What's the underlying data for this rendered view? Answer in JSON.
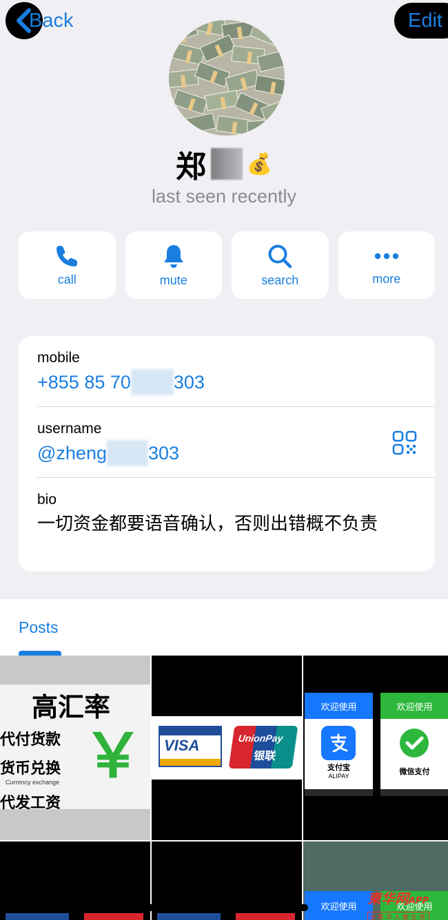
{
  "nav": {
    "back_label": "Back",
    "edit_label": "Edit"
  },
  "profile": {
    "name_visible": "郑",
    "name_emoji": "💰",
    "status": "last seen recently",
    "avatar_icon": "money-stacks-avatar"
  },
  "actions": [
    {
      "label": "call",
      "icon": "phone-icon"
    },
    {
      "label": "mute",
      "icon": "bell-icon"
    },
    {
      "label": "search",
      "icon": "search-icon"
    },
    {
      "label": "more",
      "icon": "ellipsis-icon"
    }
  ],
  "info": {
    "mobile_label": "mobile",
    "mobile_value_start": "+855 85 70",
    "mobile_value_end": "303",
    "username_label": "username",
    "username_value_start": "@zheng",
    "username_value_end": "303",
    "bio_label": "bio",
    "bio_text": "一切资金都要语音确认，否则出错概不负责",
    "qr_icon": "qr-code-icon"
  },
  "posts": {
    "tab_label": "Posts",
    "rate": {
      "title": "高汇率",
      "line1": "代付货款",
      "line2": "货币兑换",
      "small": "Currency exchange",
      "line3": "代发工资",
      "symbol": "￥"
    },
    "cards": {
      "visa": "VISA",
      "unionpay": "UnionPay",
      "unionpay_cn": "银联"
    },
    "payments": {
      "welcome": "欢迎使用",
      "alipay_name": "支付宝",
      "alipay_sub": "ALIPAY",
      "wechat_name": "微信支付"
    }
  },
  "watermark": {
    "main": "柬华网",
    "app": "APP",
    "sub": "全柬华人都在用"
  },
  "colors": {
    "accent": "#1a7ee0",
    "background": "#f0f0f4",
    "card": "#ffffff",
    "alipay": "#1677ff",
    "wechat": "#2db83d"
  }
}
